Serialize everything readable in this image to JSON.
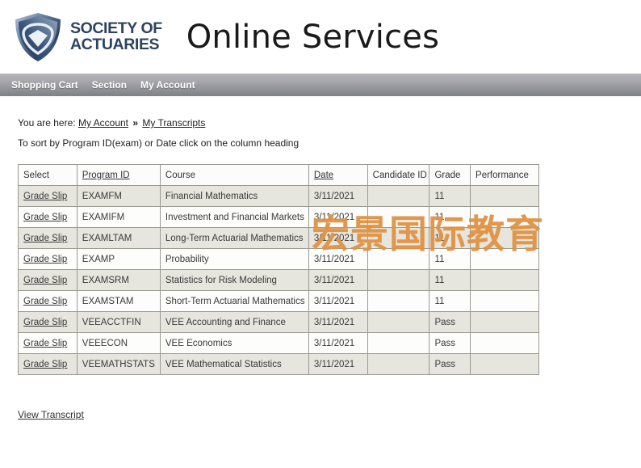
{
  "brand": {
    "logo_line1": "SOCIETY OF",
    "logo_line2": "ACTUARIES",
    "logo_icon": "shield-icon",
    "app_title": "Online Services"
  },
  "nav": {
    "items": [
      {
        "label": "Shopping Cart",
        "name": "nav-shopping-cart"
      },
      {
        "label": "Section",
        "name": "nav-section"
      },
      {
        "label": "My Account",
        "name": "nav-my-account"
      }
    ]
  },
  "breadcrumb": {
    "prefix": "You are here:",
    "link1": "My Account",
    "separator": "»",
    "link2": "My Transcripts"
  },
  "instructions": {
    "sort_hint": "To sort by Program ID(exam) or Date click on the column heading"
  },
  "watermark": {
    "text": "宏景国际教育",
    "color": "#e09344"
  },
  "table": {
    "columns": [
      {
        "label": "Select",
        "sortable": false
      },
      {
        "label": "Program ID",
        "sortable": true
      },
      {
        "label": "Course",
        "sortable": false
      },
      {
        "label": "Date",
        "sortable": true
      },
      {
        "label": "Candidate ID",
        "sortable": false
      },
      {
        "label": "Grade",
        "sortable": false
      },
      {
        "label": "Performance",
        "sortable": false
      }
    ],
    "select_label": "Grade Slip",
    "rows": [
      {
        "select": "Grade Slip",
        "program_id": "EXAMFM",
        "course": "Financial Mathematics",
        "date": "3/11/2021",
        "candidate_id": "",
        "grade": "11",
        "performance": ""
      },
      {
        "select": "Grade Slip",
        "program_id": "EXAMIFM",
        "course": "Investment and Financial Markets",
        "date": "3/11/2021",
        "candidate_id": "",
        "grade": "11",
        "performance": ""
      },
      {
        "select": "Grade Slip",
        "program_id": "EXAMLTAM",
        "course": "Long-Term Actuarial Mathematics",
        "date": "3/11/2021",
        "candidate_id": "",
        "grade": "11",
        "performance": ""
      },
      {
        "select": "Grade Slip",
        "program_id": "EXAMP",
        "course": "Probability",
        "date": "3/11/2021",
        "candidate_id": "",
        "grade": "11",
        "performance": ""
      },
      {
        "select": "Grade Slip",
        "program_id": "EXAMSRM",
        "course": "Statistics for Risk Modeling",
        "date": "3/11/2021",
        "candidate_id": "",
        "grade": "11",
        "performance": ""
      },
      {
        "select": "Grade Slip",
        "program_id": "EXAMSTAM",
        "course": "Short-Term Actuarial Mathematics",
        "date": "3/11/2021",
        "candidate_id": "",
        "grade": "11",
        "performance": ""
      },
      {
        "select": "Grade Slip",
        "program_id": "VEEACCTFIN",
        "course": "VEE Accounting and Finance",
        "date": "3/11/2021",
        "candidate_id": "",
        "grade": "Pass",
        "performance": ""
      },
      {
        "select": "Grade Slip",
        "program_id": "VEEECON",
        "course": "VEE Economics",
        "date": "3/11/2021",
        "candidate_id": "",
        "grade": "Pass",
        "performance": ""
      },
      {
        "select": "Grade Slip",
        "program_id": "VEEMATHSTATS",
        "course": "VEE Mathematical Statistics",
        "date": "3/11/2021",
        "candidate_id": "",
        "grade": "Pass",
        "performance": ""
      }
    ]
  },
  "footer": {
    "view_transcript": "View Transcript"
  }
}
